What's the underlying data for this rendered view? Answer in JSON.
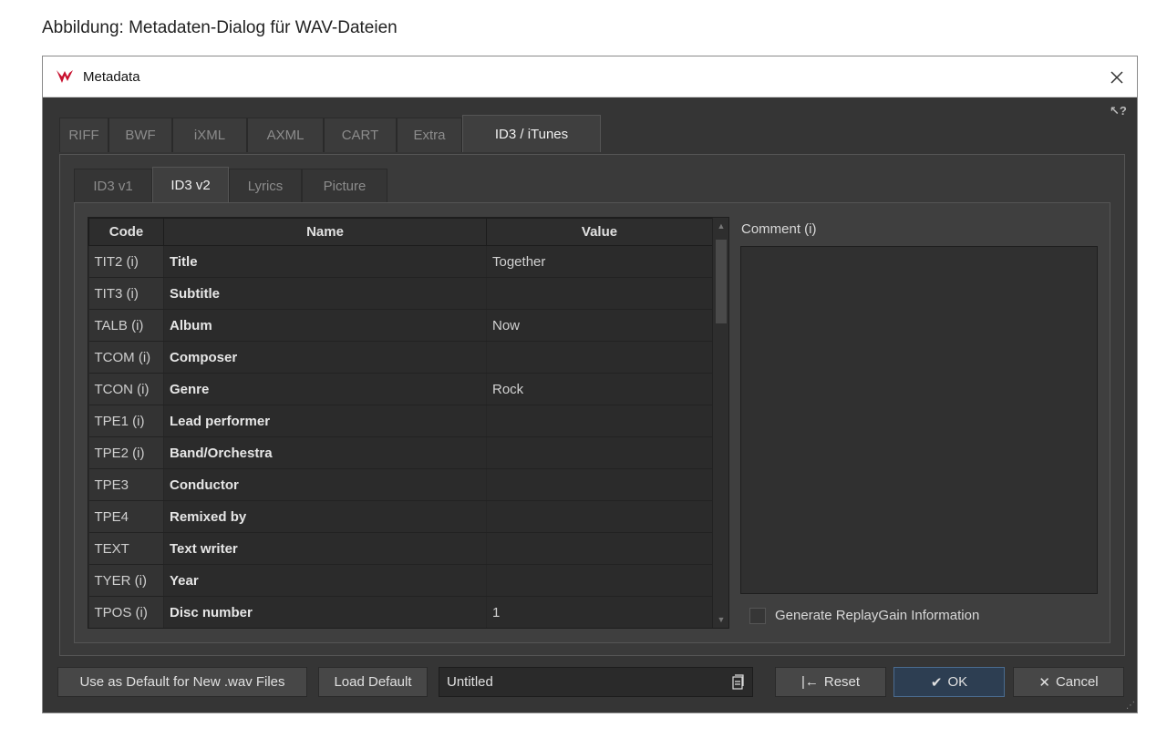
{
  "caption": "Abbildung: Metadaten-Dialog für WAV-Dateien",
  "window": {
    "title": "Metadata"
  },
  "tabs": [
    "RIFF",
    "BWF",
    "iXML",
    "AXML",
    "CART",
    "Extra",
    "ID3 / iTunes"
  ],
  "active_tab": "ID3 / iTunes",
  "subtabs": [
    "ID3 v1",
    "ID3 v2",
    "Lyrics",
    "Picture"
  ],
  "active_subtab": "ID3 v2",
  "grid": {
    "headers": {
      "code": "Code",
      "name": "Name",
      "value": "Value"
    },
    "rows": [
      {
        "code": "TIT2 (i)",
        "name": "Title",
        "value": "Together"
      },
      {
        "code": "TIT3 (i)",
        "name": "Subtitle",
        "value": ""
      },
      {
        "code": "TALB (i)",
        "name": "Album",
        "value": "Now"
      },
      {
        "code": "TCOM (i)",
        "name": "Composer",
        "value": ""
      },
      {
        "code": "TCON (i)",
        "name": "Genre",
        "value": "Rock"
      },
      {
        "code": "TPE1 (i)",
        "name": "Lead performer",
        "value": ""
      },
      {
        "code": "TPE2 (i)",
        "name": "Band/Orchestra",
        "value": ""
      },
      {
        "code": "TPE3",
        "name": "Conductor",
        "value": ""
      },
      {
        "code": "TPE4",
        "name": "Remixed by",
        "value": ""
      },
      {
        "code": "TEXT",
        "name": "Text writer",
        "value": ""
      },
      {
        "code": "TYER (i)",
        "name": "Year",
        "value": ""
      },
      {
        "code": "TPOS (i)",
        "name": "Disc number",
        "value": "1"
      }
    ]
  },
  "comment": {
    "label": "Comment (i)",
    "value": ""
  },
  "replaygain_label": "Generate ReplayGain Information",
  "buttons": {
    "use_default": "Use as Default for New .wav Files",
    "load_default": "Load Default",
    "reset": "Reset",
    "ok": "OK",
    "cancel": "Cancel"
  },
  "preset_name": "Untitled"
}
